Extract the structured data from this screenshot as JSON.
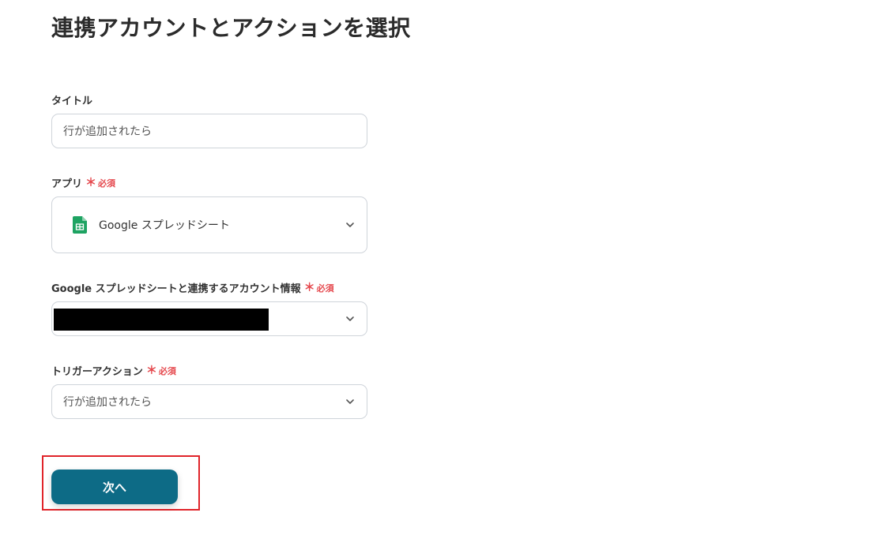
{
  "page": {
    "title": "連携アカウントとアクションを選択"
  },
  "form": {
    "title_field": {
      "label": "タイトル",
      "value": "行が追加されたら"
    },
    "app_field": {
      "label": "アプリ",
      "required_mark": "＊",
      "required_label": "必須",
      "selected_app": "Google スプレッドシート",
      "icon": "google-sheets-icon"
    },
    "account_field": {
      "label": "Google スプレッドシートと連携するアカウント情報",
      "required_mark": "＊",
      "required_label": "必須"
    },
    "trigger_field": {
      "label": "トリガーアクション",
      "required_mark": "＊",
      "required_label": "必須",
      "value": "行が追加されたら"
    }
  },
  "actions": {
    "next_label": "次へ"
  },
  "colors": {
    "accent": "#0d6b86",
    "required": "#e5484d",
    "highlight": "#e0242a",
    "sheets_green": "#1ea362"
  }
}
